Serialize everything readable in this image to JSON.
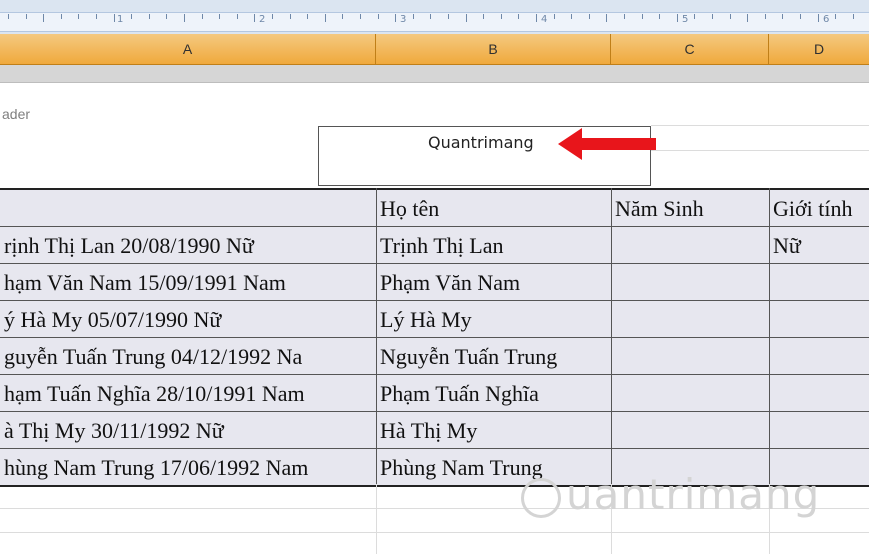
{
  "ruler": {
    "numbers": [
      "1",
      "2",
      "3",
      "4",
      "5",
      "6"
    ]
  },
  "columns": [
    "A",
    "B",
    "C",
    "D"
  ],
  "header_label": "ader",
  "header_box_text": "Quantrimang",
  "arrow_color": "#e8151b",
  "table": {
    "headers": [
      "",
      "Họ tên",
      "Năm Sinh",
      "Giới tính"
    ],
    "rows": [
      [
        "rịnh Thị Lan 20/08/1990 Nữ",
        "Trịnh Thị Lan",
        "",
        "Nữ"
      ],
      [
        "hạm Văn Nam 15/09/1991 Nam",
        "Phạm Văn Nam",
        "",
        ""
      ],
      [
        "ý Hà My 05/07/1990 Nữ",
        "Lý Hà My",
        "",
        ""
      ],
      [
        "guyễn Tuấn Trung 04/12/1992 Na",
        "Nguyễn Tuấn Trung",
        "",
        ""
      ],
      [
        "hạm Tuấn Nghĩa 28/10/1991 Nam",
        "Phạm Tuấn Nghĩa",
        "",
        ""
      ],
      [
        "à Thị My 30/11/1992 Nữ",
        "Hà Thị My",
        "",
        ""
      ],
      [
        "hùng Nam Trung 17/06/1992 Nam",
        "Phùng Nam Trung",
        "",
        ""
      ]
    ]
  },
  "watermark": "uantrimang"
}
